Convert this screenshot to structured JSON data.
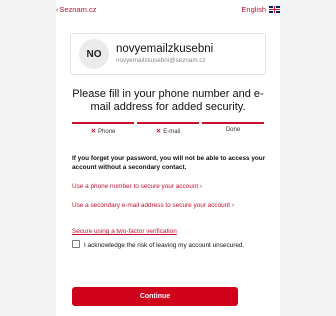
{
  "topbar": {
    "back_label": "Seznam.cz",
    "language_label": "English"
  },
  "account": {
    "initials": "NO",
    "username": "novyemailzkusebni",
    "email": "novyemailzkusebni@seznam.cz"
  },
  "headline": "Please fill in your phone number and e-mail address for added security.",
  "steps": [
    {
      "label": "Phone",
      "status": "missing"
    },
    {
      "label": "E-mail",
      "status": "missing"
    },
    {
      "label": "Done",
      "status": "pending"
    }
  ],
  "warning": "If you forget your password, you will not be able to access your account without a secondary contact.",
  "options": {
    "phone_link": "Use a phone number to secure your account ›",
    "email_link": "Use a secondary e-mail address to secure your account ›",
    "twofactor_link": "Secure using a two-factor verification"
  },
  "acknowledge_label": "I acknowledge the risk of leaving my account unsecured.",
  "continue_label": "Continue",
  "colors": {
    "accent": "#c8102e",
    "button": "#d0021b"
  }
}
